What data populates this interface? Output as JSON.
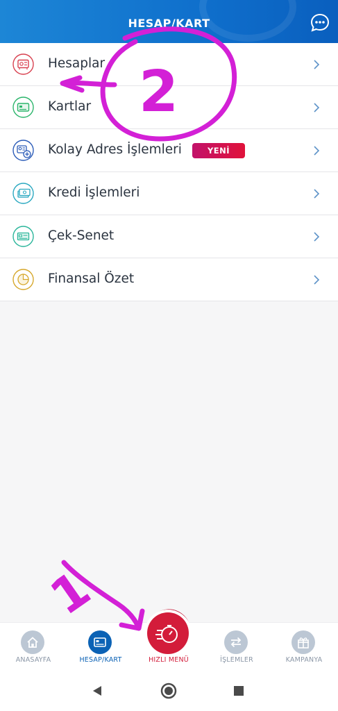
{
  "header": {
    "title": "HESAP/KART",
    "chat_icon": "chat-bubble-icon"
  },
  "menu": [
    {
      "label": "Hesaplar",
      "icon": "safe-icon",
      "color": "#d8404f"
    },
    {
      "label": "Kartlar",
      "icon": "card-icon",
      "color": "#2bb56b"
    },
    {
      "label": "Kolay Adres İşlemleri",
      "icon": "address-card-icon",
      "color": "#2a5bb8",
      "badge": "YENİ"
    },
    {
      "label": "Kredi İşlemleri",
      "icon": "cash-icon",
      "color": "#2aa8c0"
    },
    {
      "label": "Çek-Senet",
      "icon": "cheque-icon",
      "color": "#29b59a"
    },
    {
      "label": "Finansal Özet",
      "icon": "pie-chart-icon",
      "color": "#d6a72b"
    }
  ],
  "nav": {
    "home": "ANASAYFA",
    "account": "HESAP/KART",
    "quick": "HIZLI MENÜ",
    "transactions": "İŞLEMLER",
    "campaign": "KAMPANYA"
  },
  "annotations": {
    "one": "1",
    "two": "2"
  },
  "colors": {
    "brand": "#0f6fcc",
    "accent": "#d31c3a",
    "marker": "#d320d6"
  }
}
